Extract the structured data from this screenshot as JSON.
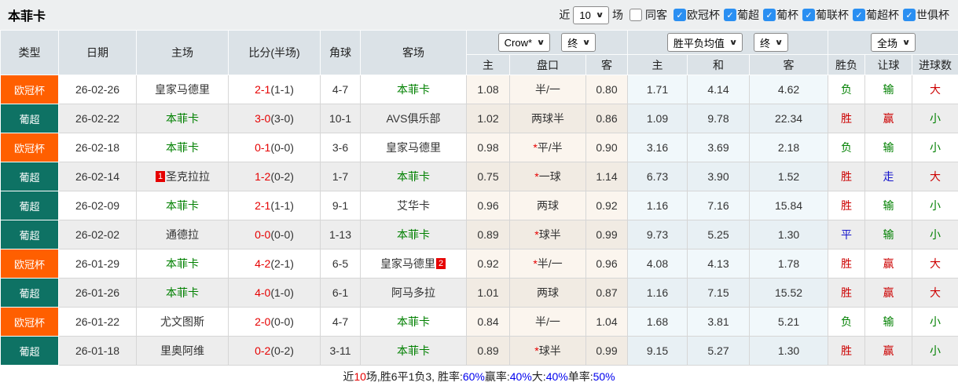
{
  "colors": {
    "league": {
      "欧冠杯": "#ff5f00",
      "葡超": "#0e7264"
    },
    "accent_red": "#e60000",
    "accent_green": "#008000",
    "accent_blue": "#1515cc",
    "checkbox_blue": "#2a8ff2"
  },
  "topbar": {
    "title": "本菲卡",
    "near_label": "近",
    "count_select": "10",
    "unit_label": "场",
    "same_away_label": "同客",
    "league_filters": [
      {
        "label": "欧冠杯",
        "checked": true
      },
      {
        "label": "葡超",
        "checked": true
      },
      {
        "label": "葡杯",
        "checked": true
      },
      {
        "label": "葡联杯",
        "checked": true
      },
      {
        "label": "葡超杯",
        "checked": true
      },
      {
        "label": "世俱杯",
        "checked": true
      }
    ]
  },
  "table": {
    "main_headers": [
      "类型",
      "日期",
      "主场",
      "比分(半场)",
      "角球",
      "客场"
    ],
    "sub_headers": [
      "主",
      "盘口",
      "客",
      "主",
      "和",
      "客",
      "胜负",
      "让球",
      "进球数"
    ],
    "selects": {
      "company": "Crow*",
      "company_state": "终",
      "avg": "胜平负均值",
      "avg_state": "终",
      "scope": "全场"
    },
    "rows": [
      {
        "league": "欧冠杯",
        "date": "26-02-26",
        "home": "皇家马德里",
        "home_green": false,
        "home_badge": "",
        "score": "2-1",
        "half": "(1-1)",
        "corner": "4-7",
        "away": "本菲卡",
        "away_green": true,
        "away_badge": "",
        "odds_home": "1.08",
        "handicap": "半/一",
        "odds_away": "0.80",
        "avg_home": "1.71",
        "avg_draw": "4.14",
        "avg_away": "4.62",
        "result_wdl": "负",
        "result_handicap": "输",
        "result_goals": "大"
      },
      {
        "league": "葡超",
        "date": "26-02-22",
        "home": "本菲卡",
        "home_green": true,
        "home_badge": "",
        "score": "3-0",
        "half": "(3-0)",
        "corner": "10-1",
        "away": "AVS俱乐部",
        "away_green": false,
        "away_badge": "",
        "odds_home": "1.02",
        "handicap": "两球半",
        "odds_away": "0.86",
        "avg_home": "1.09",
        "avg_draw": "9.78",
        "avg_away": "22.34",
        "result_wdl": "胜",
        "result_handicap": "赢",
        "result_goals": "小"
      },
      {
        "league": "欧冠杯",
        "date": "26-02-18",
        "home": "本菲卡",
        "home_green": true,
        "home_badge": "",
        "score": "0-1",
        "half": "(0-0)",
        "corner": "3-6",
        "away": "皇家马德里",
        "away_green": false,
        "away_badge": "",
        "odds_home": "0.98",
        "handicap": "*平/半",
        "odds_away": "0.90",
        "avg_home": "3.16",
        "avg_draw": "3.69",
        "avg_away": "2.18",
        "result_wdl": "负",
        "result_handicap": "输",
        "result_goals": "小"
      },
      {
        "league": "葡超",
        "date": "26-02-14",
        "home": "圣克拉拉",
        "home_green": false,
        "home_badge": "1",
        "score": "1-2",
        "half": "(0-2)",
        "corner": "1-7",
        "away": "本菲卡",
        "away_green": true,
        "away_badge": "",
        "odds_home": "0.75",
        "handicap": "*一球",
        "odds_away": "1.14",
        "avg_home": "6.73",
        "avg_draw": "3.90",
        "avg_away": "1.52",
        "result_wdl": "胜",
        "result_handicap": "走",
        "result_goals": "大"
      },
      {
        "league": "葡超",
        "date": "26-02-09",
        "home": "本菲卡",
        "home_green": true,
        "home_badge": "",
        "score": "2-1",
        "half": "(1-1)",
        "corner": "9-1",
        "away": "艾华卡",
        "away_green": false,
        "away_badge": "",
        "odds_home": "0.96",
        "handicap": "两球",
        "odds_away": "0.92",
        "avg_home": "1.16",
        "avg_draw": "7.16",
        "avg_away": "15.84",
        "result_wdl": "胜",
        "result_handicap": "输",
        "result_goals": "小"
      },
      {
        "league": "葡超",
        "date": "26-02-02",
        "home": "通德拉",
        "home_green": false,
        "home_badge": "",
        "score": "0-0",
        "half": "(0-0)",
        "corner": "1-13",
        "away": "本菲卡",
        "away_green": true,
        "away_badge": "",
        "odds_home": "0.89",
        "handicap": "*球半",
        "odds_away": "0.99",
        "avg_home": "9.73",
        "avg_draw": "5.25",
        "avg_away": "1.30",
        "result_wdl": "平",
        "result_handicap": "输",
        "result_goals": "小"
      },
      {
        "league": "欧冠杯",
        "date": "26-01-29",
        "home": "本菲卡",
        "home_green": true,
        "home_badge": "",
        "score": "4-2",
        "half": "(2-1)",
        "corner": "6-5",
        "away": "皇家马德里",
        "away_green": false,
        "away_badge": "2",
        "odds_home": "0.92",
        "handicap": "*半/一",
        "odds_away": "0.96",
        "avg_home": "4.08",
        "avg_draw": "4.13",
        "avg_away": "1.78",
        "result_wdl": "胜",
        "result_handicap": "赢",
        "result_goals": "大"
      },
      {
        "league": "葡超",
        "date": "26-01-26",
        "home": "本菲卡",
        "home_green": true,
        "home_badge": "",
        "score": "4-0",
        "half": "(1-0)",
        "corner": "6-1",
        "away": "阿马多拉",
        "away_green": false,
        "away_badge": "",
        "odds_home": "1.01",
        "handicap": "两球",
        "odds_away": "0.87",
        "avg_home": "1.16",
        "avg_draw": "7.15",
        "avg_away": "15.52",
        "result_wdl": "胜",
        "result_handicap": "赢",
        "result_goals": "大"
      },
      {
        "league": "欧冠杯",
        "date": "26-01-22",
        "home": "尤文图斯",
        "home_green": false,
        "home_badge": "",
        "score": "2-0",
        "half": "(0-0)",
        "corner": "4-7",
        "away": "本菲卡",
        "away_green": true,
        "away_badge": "",
        "odds_home": "0.84",
        "handicap": "半/一",
        "odds_away": "1.04",
        "avg_home": "1.68",
        "avg_draw": "3.81",
        "avg_away": "5.21",
        "result_wdl": "负",
        "result_handicap": "输",
        "result_goals": "小"
      },
      {
        "league": "葡超",
        "date": "26-01-18",
        "home": "里奥阿维",
        "home_green": false,
        "home_badge": "",
        "score": "0-2",
        "half": "(0-2)",
        "corner": "3-11",
        "away": "本菲卡",
        "away_green": true,
        "away_badge": "",
        "odds_home": "0.89",
        "handicap": "*球半",
        "odds_away": "0.99",
        "avg_home": "9.15",
        "avg_draw": "5.27",
        "avg_away": "1.30",
        "result_wdl": "胜",
        "result_handicap": "赢",
        "result_goals": "小"
      }
    ]
  },
  "footer": {
    "segments": [
      {
        "text": "近"
      },
      {
        "text": "10",
        "color": "red"
      },
      {
        "text": "场,胜6平1负3, 胜率:"
      },
      {
        "text": "60%",
        "color": "blue"
      },
      {
        "text": " 赢率:"
      },
      {
        "text": "40%",
        "color": "blue"
      },
      {
        "text": " 大:"
      },
      {
        "text": "40%",
        "color": "blue"
      },
      {
        "text": " 单率:"
      },
      {
        "text": "50%",
        "color": "blue"
      }
    ]
  }
}
